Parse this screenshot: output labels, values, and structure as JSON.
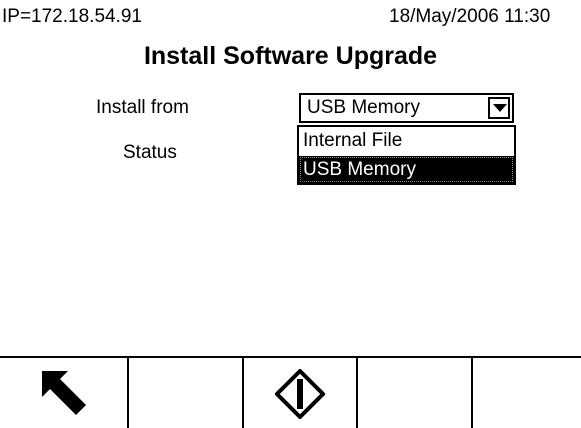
{
  "status_bar": {
    "ip": "IP=172.18.54.91",
    "datetime": "18/May/2006 11:30"
  },
  "page": {
    "title": "Install Software Upgrade"
  },
  "form": {
    "install_from_label": "Install from",
    "install_from_value": "USB Memory",
    "status_label": "Status",
    "options": [
      "Internal File",
      "USB Memory"
    ],
    "selected_option": "USB Memory"
  },
  "softkeys": [
    {
      "icon": "up-left-arrow-icon"
    },
    {
      "icon": ""
    },
    {
      "icon": "start-diamond-icon"
    },
    {
      "icon": ""
    },
    {
      "icon": ""
    }
  ]
}
